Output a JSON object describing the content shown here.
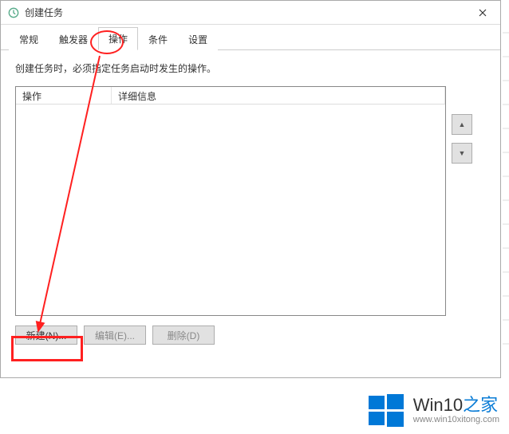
{
  "window": {
    "title": "创建任务"
  },
  "tabs": {
    "general": "常规",
    "triggers": "触发器",
    "actions": "操作",
    "conditions": "条件",
    "settings": "设置"
  },
  "content": {
    "description": "创建任务时，必须指定任务启动时发生的操作。"
  },
  "table": {
    "col_action": "操作",
    "col_details": "详细信息"
  },
  "buttons": {
    "new": "新建(N)...",
    "edit": "编辑(E)...",
    "delete": "删除(D)",
    "move_up": "▲",
    "move_down": "▼"
  },
  "watermark": {
    "brand_prefix": "Win10",
    "brand_suffix": "之家",
    "url": "www.win10xitong.com"
  }
}
